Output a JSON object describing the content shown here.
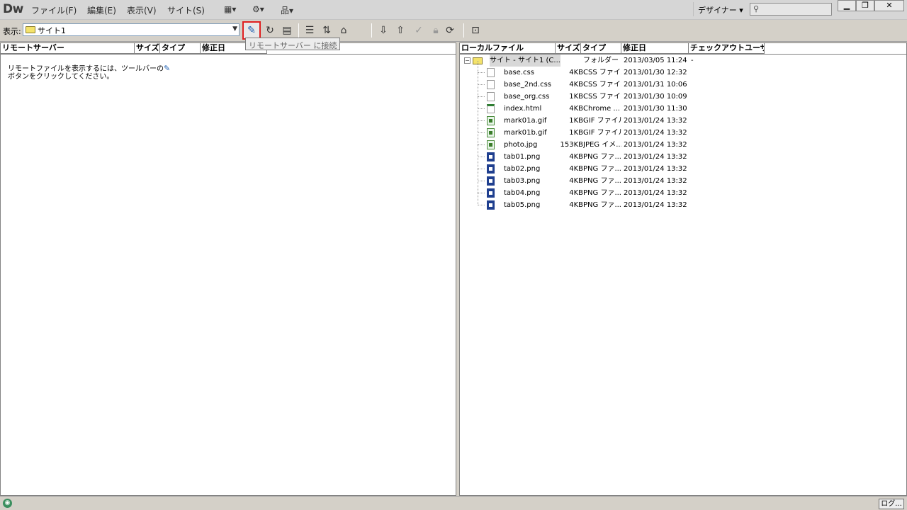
{
  "app": {
    "logo": "Dw"
  },
  "menu": {
    "file": "ファイル(F)",
    "edit": "編集(E)",
    "view": "表示(V)",
    "site": "サイト(S)",
    "layout_icon": "▦▾",
    "gear_icon": "⚙▾",
    "sitemgr_icon": "品▾",
    "workspace": "デザイナー ▾"
  },
  "window": {
    "minimize": "▁",
    "restore": "❐",
    "close": "✕"
  },
  "toolbar": {
    "view_label": "表示:",
    "site_selected": "サイト1",
    "connect_tooltip": "リモートサーバー に接続"
  },
  "left_panel": {
    "columns": [
      "リモートサーバー",
      "サイズ",
      "タイプ",
      "修正日"
    ],
    "empty_message_line1": "リモートファイルを表示するには、ツールバーの",
    "empty_message_line2": "ボタンをクリックしてください。"
  },
  "right_panel": {
    "columns": [
      "ローカルファイル",
      "サイズ",
      "タイプ",
      "修正日",
      "チェックアウトユーザー"
    ],
    "root": {
      "name": "サイト - サイト1 (C...",
      "size": "",
      "type": "フォルダー",
      "modified": "2013/03/05 11:24",
      "checkout": "-"
    },
    "files": [
      {
        "name": "base.css",
        "size": "4KB",
        "type": "CSS ファイ...",
        "modified": "2013/01/30 12:32",
        "icon": "css"
      },
      {
        "name": "base_2nd.css",
        "size": "4KB",
        "type": "CSS ファイ...",
        "modified": "2013/01/31 10:06",
        "icon": "css"
      },
      {
        "name": "base_org.css",
        "size": "1KB",
        "type": "CSS ファイ...",
        "modified": "2013/01/30 10:09",
        "icon": "css"
      },
      {
        "name": "index.html",
        "size": "4KB",
        "type": "Chrome ...",
        "modified": "2013/01/30 11:30",
        "icon": "html"
      },
      {
        "name": "mark01a.gif",
        "size": "1KB",
        "type": "GIF ファイル",
        "modified": "2013/01/24 13:32",
        "icon": "img"
      },
      {
        "name": "mark01b.gif",
        "size": "1KB",
        "type": "GIF ファイル",
        "modified": "2013/01/24 13:32",
        "icon": "img"
      },
      {
        "name": "photo.jpg",
        "size": "153KB",
        "type": "JPEG イメ...",
        "modified": "2013/01/24 13:32",
        "icon": "img"
      },
      {
        "name": "tab01.png",
        "size": "4KB",
        "type": "PNG ファ...",
        "modified": "2013/01/24 13:32",
        "icon": "png"
      },
      {
        "name": "tab02.png",
        "size": "4KB",
        "type": "PNG ファ...",
        "modified": "2013/01/24 13:32",
        "icon": "png"
      },
      {
        "name": "tab03.png",
        "size": "4KB",
        "type": "PNG ファ...",
        "modified": "2013/01/24 13:32",
        "icon": "png"
      },
      {
        "name": "tab04.png",
        "size": "4KB",
        "type": "PNG ファ...",
        "modified": "2013/01/24 13:32",
        "icon": "png"
      },
      {
        "name": "tab05.png",
        "size": "4KB",
        "type": "PNG ファ...",
        "modified": "2013/01/24 13:32",
        "icon": "png"
      }
    ]
  },
  "statusbar": {
    "log_button": "ログ..."
  },
  "colors": {
    "highlight_border": "#e02020",
    "connect_icon": "#1e5fb0"
  }
}
